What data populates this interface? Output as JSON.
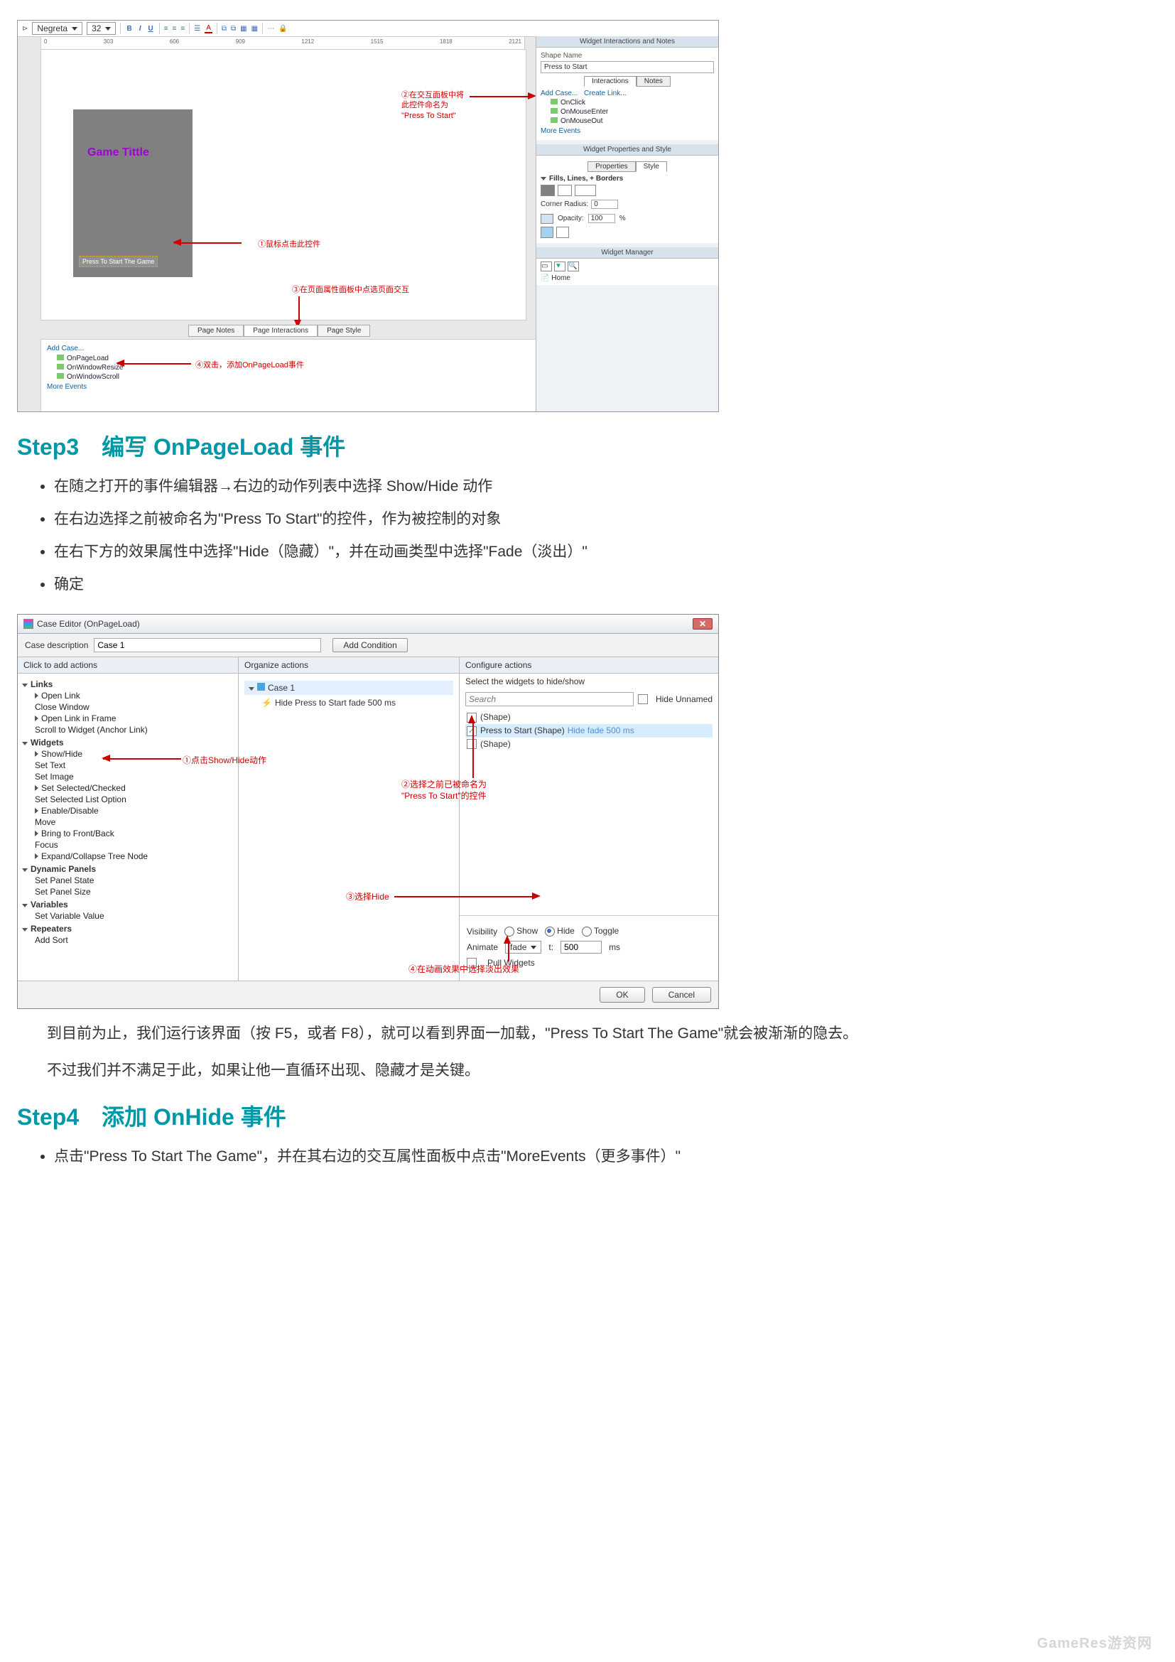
{
  "toolbar": {
    "font": "Negreta",
    "size": "32",
    "buttons": [
      "B",
      "I",
      "U"
    ]
  },
  "tab": {
    "label": "Home"
  },
  "ruler_ticks": [
    "0",
    "303",
    "606",
    "909",
    "1212",
    "1515",
    "1818",
    "2121"
  ],
  "canvas": {
    "game_title": "Game Tittle",
    "press_label": "Press To  Start The Game"
  },
  "annotations1": {
    "a1": "①鼠标点击此控件",
    "a2": "②在交互面板中将\n此控件命名为\n\"Press To Start\"",
    "a3": "③在页面属性面板中点选页面交互",
    "a4": "④双击，添加OnPageLoad事件"
  },
  "right_panel": {
    "head1": "Widget Interactions and Notes",
    "shape_name_label": "Shape Name",
    "shape_name_value": "Press to Start",
    "tab_interactions": "Interactions",
    "tab_notes": "Notes",
    "add_case": "Add Case...",
    "create_link": "Create Link...",
    "events": [
      "OnClick",
      "OnMouseEnter",
      "OnMouseOut"
    ],
    "more_events": "More Events",
    "head2": "Widget Properties and Style",
    "tab_properties": "Properties",
    "tab_style": "Style",
    "fills_label": "Fills, Lines, + Borders",
    "corner_radius_label": "Corner Radius:",
    "corner_radius_value": "0",
    "opacity_label": "Opacity:",
    "opacity_value": "100",
    "opacity_unit": "%",
    "head3": "Widget Manager",
    "wm_item": "Home"
  },
  "bottom_tabs": {
    "t1": "Page Notes",
    "t2": "Page Interactions",
    "t3": "Page Style"
  },
  "bottom_pane": {
    "add_case": "Add Case...",
    "events": [
      "OnPageLoad",
      "OnWindowResize",
      "OnWindowScroll"
    ],
    "more_events": "More Events"
  },
  "step3": {
    "title": "Step3　编写 OnPageLoad 事件",
    "b1": "在随之打开的事件编辑器→右边的动作列表中选择 Show/Hide 动作",
    "b2": "在右边选择之前被命名为\"Press To Start\"的控件，作为被控制的对象",
    "b3": "在右下方的效果属性中选择\"Hide（隐藏）\"，并在动画类型中选择\"Fade（淡出）\"",
    "b4": "确定"
  },
  "shot2": {
    "title": "Case Editor (OnPageLoad)",
    "close": "✕",
    "desc_label": "Case description",
    "desc_value": "Case 1",
    "add_condition": "Add Condition",
    "col1_h": "Click to add actions",
    "col2_h": "Organize actions",
    "col3_h": "Configure actions",
    "links_grp": "Links",
    "links": [
      "Open Link",
      "Close Window",
      "Open Link in Frame",
      "Scroll to Widget (Anchor Link)"
    ],
    "widgets_grp": "Widgets",
    "widgets": [
      "Show/Hide",
      "Set Text",
      "Set Image",
      "Set Selected/Checked",
      "Set Selected List Option",
      "Enable/Disable",
      "Move",
      "Bring to Front/Back",
      "Focus",
      "Expand/Collapse Tree Node"
    ],
    "dynp_grp": "Dynamic Panels",
    "dynp": [
      "Set Panel State",
      "Set Panel Size"
    ],
    "vars_grp": "Variables",
    "vars": [
      "Set Variable Value"
    ],
    "rep_grp": "Repeaters",
    "rep": [
      "Add Sort"
    ],
    "case_node": "Case 1",
    "action_node": "Hide Press to Start fade 500 ms",
    "select_widgets": "Select the widgets to hide/show",
    "search_ph": "Search",
    "hide_unnamed": "Hide Unnamed",
    "wrows": {
      "r1": "(Shape)",
      "r2_name": "Press to Start (Shape)",
      "r2_meta": "Hide fade 500 ms",
      "r3": "(Shape)"
    },
    "vis_label": "Visibility",
    "vis_show": "Show",
    "vis_hide": "Hide",
    "vis_toggle": "Toggle",
    "anim_label": "Animate",
    "anim_value": "fade",
    "t_label": "t:",
    "t_value": "500",
    "t_unit": "ms",
    "pull": "Pull Widgets",
    "ok": "OK",
    "cancel": "Cancel",
    "anno1": "①点击Show/Hide动作",
    "anno2": "②选择之前已被命名为\n\"Press To Start\"的控件",
    "anno3": "③选择Hide",
    "anno4": "④在动画效果中选择淡出效果"
  },
  "para1": "到目前为止，我们运行该界面（按 F5，或者 F8），就可以看到界面一加载，\"Press To Start The Game\"就会被渐渐的隐去。",
  "para2": "不过我们并不满足于此，如果让他一直循环出现、隐藏才是关键。",
  "step4": {
    "title": "Step4　添加 OnHide 事件",
    "b1": "点击\"Press To Start The Game\"，并在其右边的交互属性面板中点击\"MoreEvents（更多事件）\""
  },
  "watermark": "GameRes游资网"
}
